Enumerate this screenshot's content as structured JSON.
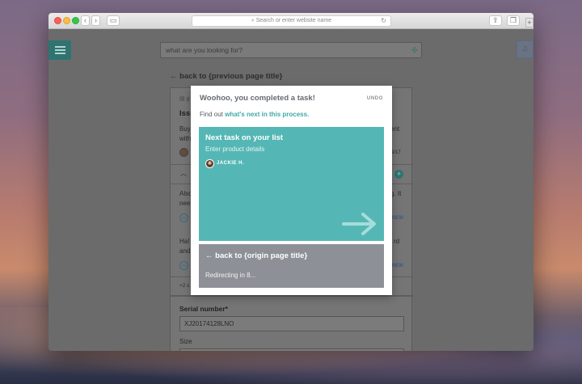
{
  "browser": {
    "url_placeholder": "Search or enter website name",
    "reload_icon": "reload-icon",
    "share_icon": "share-icon",
    "tabs_icon": "tabs-icon",
    "sidebar_icon": "sidebar-icon"
  },
  "header": {
    "search_placeholder": "what are you looking for?",
    "menu_icon": "hamburger-icon",
    "bell_icon": "bell-icon"
  },
  "background_page": {
    "back_link": "← back to {previous page title}",
    "issue_title": "Issu",
    "body_line1": "Buy",
    "body_line1_end": "ent",
    "body_line2": "with",
    "date_fragment": "9/17",
    "comment1_line1": "Also",
    "comment1_line1_end": "g. It",
    "comment1_line2": "nee",
    "comment2_line1": "Ha!",
    "comment2_line1_end": "rd",
    "comment2_line2": "and",
    "new_badge": "NEW",
    "more_fragment": "+2 c",
    "serial_label": "Serial number*",
    "serial_value": "XJ20174128LNO",
    "size_label": "Size"
  },
  "modal": {
    "title": "Woohoo, you completed a task!",
    "undo": "UNDO",
    "subtitle_prefix": "Find out ",
    "subtitle_link": "what's next in this process.",
    "next_card": {
      "title": "Next task on your list",
      "subtitle": "Enter product details",
      "assignee": "JACKIE H.",
      "color": "#55b7b5"
    },
    "origin_card": {
      "title": "← back to {origin page title}",
      "subtitle": "Redirecting in 8...",
      "color": "#8d9096"
    }
  },
  "colors": {
    "accent": "#3fa9a8",
    "header_dark": "#2f7471"
  }
}
